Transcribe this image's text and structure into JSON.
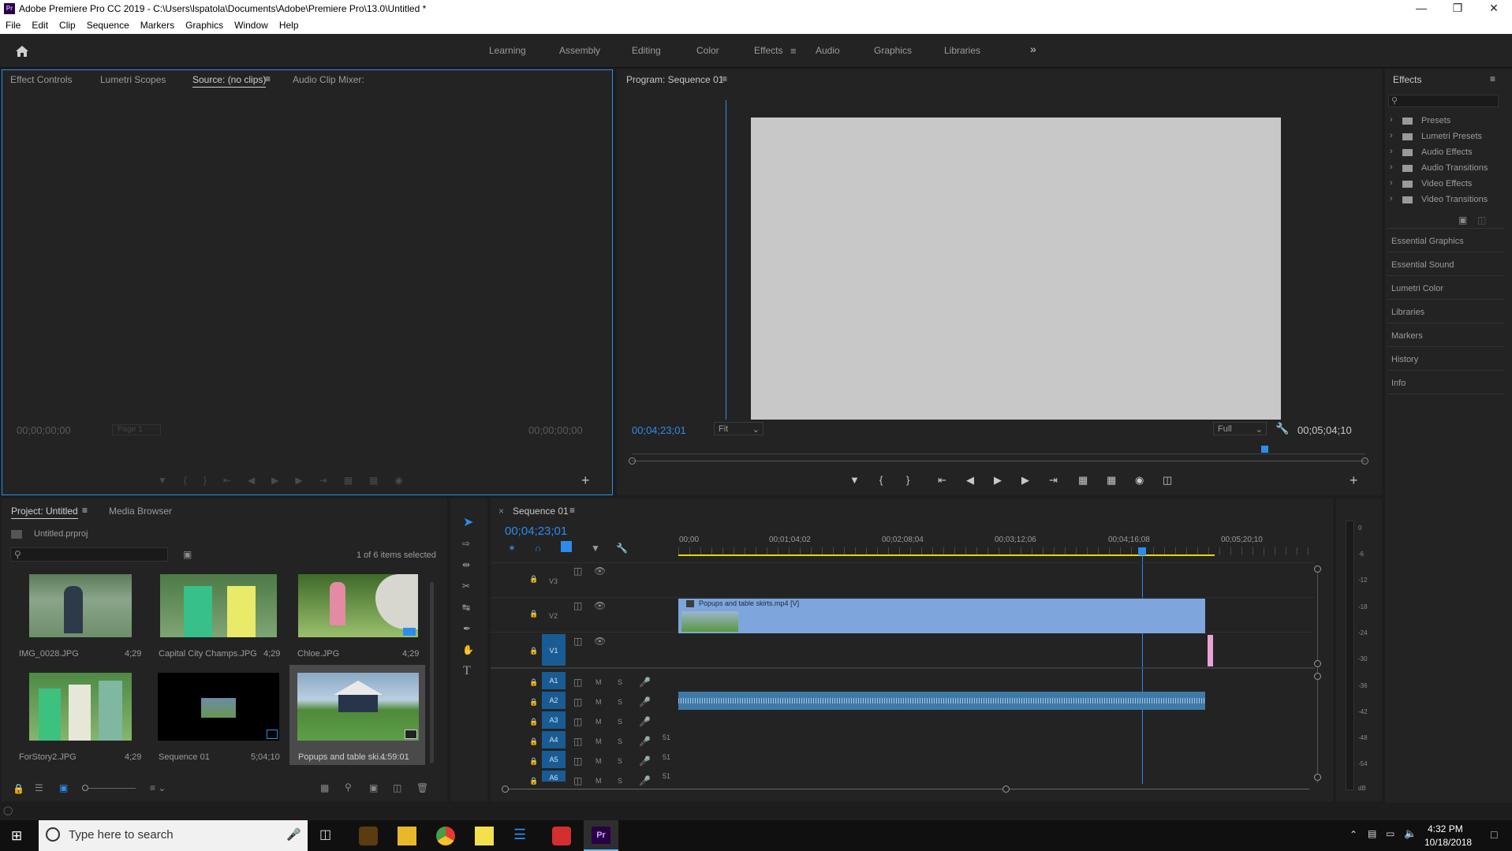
{
  "app": {
    "title": "Adobe Premiere Pro CC 2019 - C:\\Users\\lspatola\\Documents\\Adobe\\Premiere Pro\\13.0\\Untitled *",
    "icon_label": "Pr"
  },
  "menu": [
    "File",
    "Edit",
    "Clip",
    "Sequence",
    "Markers",
    "Graphics",
    "Window",
    "Help"
  ],
  "workspaces": [
    "Learning",
    "Assembly",
    "Editing",
    "Color",
    "Effects",
    "Audio",
    "Graphics",
    "Libraries"
  ],
  "workspace_active": "Effects",
  "workspace_more": "»",
  "source_panel": {
    "tabs": [
      "Effect Controls",
      "Lumetri Scopes",
      "Source: (no clips)",
      "Audio Clip Mixer:"
    ],
    "timecode_left": "00;00;00;00",
    "timecode_right": "00;00;00;00",
    "page": "Page 1"
  },
  "program_panel": {
    "title": "Program: Sequence 01",
    "timecode": "00;04;23;01",
    "fit": "Fit",
    "quality": "Full",
    "duration": "00;05;04;10"
  },
  "effects_panel": {
    "title": "Effects",
    "search_placeholder": "",
    "items": [
      "Presets",
      "Lumetri Presets",
      "Audio Effects",
      "Audio Transitions",
      "Video Effects",
      "Video Transitions"
    ]
  },
  "side_panels": [
    "Essential Graphics",
    "Essential Sound",
    "Lumetri Color",
    "Libraries",
    "Markers",
    "History",
    "Info"
  ],
  "project_panel": {
    "tabs": [
      "Project: Untitled",
      "Media Browser"
    ],
    "file": "Untitled.prproj",
    "selection": "1 of 6 items selected",
    "items": [
      {
        "name": "IMG_0028.JPG",
        "duration": "4;29"
      },
      {
        "name": "Capital City Champs.JPG",
        "duration": "4;29"
      },
      {
        "name": "Chloe.JPG",
        "duration": "4;29"
      },
      {
        "name": "ForStory2.JPG",
        "duration": "4;29"
      },
      {
        "name": "Sequence 01",
        "duration": "5;04;10"
      },
      {
        "name": "Popups and table ski...",
        "duration": "4:59:01"
      }
    ]
  },
  "timeline": {
    "title": "Sequence 01",
    "timecode": "00;04;23;01",
    "ruler": [
      "00;00",
      "00;01;04;02",
      "00;02;08;04",
      "00;03;12;06",
      "00;04;16;08",
      "00;05;20;10"
    ],
    "video_tracks": [
      "V3",
      "V2",
      "V1"
    ],
    "audio_tracks": [
      "A1",
      "A2",
      "A3",
      "A4",
      "A5",
      "A6"
    ],
    "mute_label": "M",
    "solo_label": "S",
    "level_labels": [
      "51",
      "51",
      "51"
    ],
    "clip_label": "Popups and table skirts.mp4 [V]"
  },
  "meter": {
    "labels": [
      "0",
      "-6",
      "-12",
      "-18",
      "-24",
      "-30",
      "-36",
      "-42",
      "-48",
      "-54",
      "dB"
    ]
  },
  "taskbar": {
    "search_placeholder": "Type here to search",
    "time": "4:32 PM",
    "date": "10/18/2018"
  }
}
